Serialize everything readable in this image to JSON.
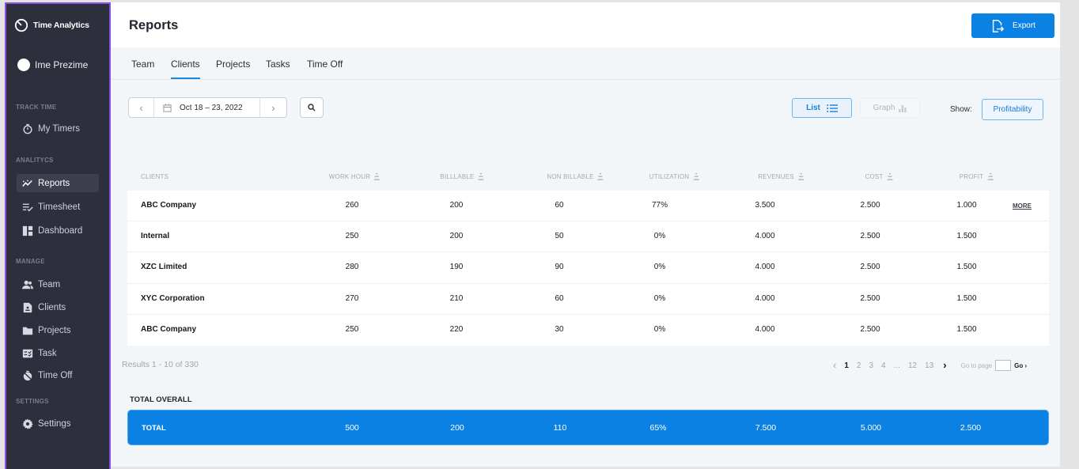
{
  "sidebar": {
    "brand": "Time Analytics",
    "user": "Ime Prezime",
    "sections": {
      "track_time": "TRACK TIME",
      "analytics": "ANALITYCS",
      "manage": "MANAGE",
      "settings": "SETTINGS"
    },
    "items": [
      {
        "label": "My Timers",
        "icon": "stopwatch-icon"
      },
      {
        "label": "Reports",
        "icon": "trend-icon",
        "active": true
      },
      {
        "label": "Timesheet",
        "icon": "checklist-icon"
      },
      {
        "label": "Dashboard",
        "icon": "dashboard-icon"
      },
      {
        "label": "Team",
        "icon": "team-icon"
      },
      {
        "label": "Clients",
        "icon": "client-icon"
      },
      {
        "label": "Projects",
        "icon": "folder-icon"
      },
      {
        "label": "Task",
        "icon": "task-icon"
      },
      {
        "label": "Time Off",
        "icon": "time-off-icon"
      },
      {
        "label": "Settings",
        "icon": "gear-icon"
      }
    ]
  },
  "header": {
    "title": "Reports",
    "export_label": "Export"
  },
  "tabs": [
    {
      "label": "Team"
    },
    {
      "label": "Clients",
      "active": true
    },
    {
      "label": "Projects"
    },
    {
      "label": "Tasks"
    },
    {
      "label": "Time Off"
    }
  ],
  "toolbar": {
    "date_range": "Oct 18 – 23, 2022",
    "list_label": "List",
    "graph_label": "Graph",
    "show_label": "Show:",
    "show_value": "Profitability"
  },
  "table": {
    "columns": [
      "CLIENTS",
      "WORK HOUR",
      "BILLLABLE",
      "NON BILLABLE",
      "UTILIZATION",
      "REVENUES",
      "COST",
      "PROFIT"
    ],
    "rows": [
      [
        "ABC Company",
        "260",
        "200",
        "60",
        "77%",
        "3.500",
        "2.500",
        "1.000"
      ],
      [
        "Internal",
        "250",
        "200",
        "50",
        "0%",
        "4.000",
        "2.500",
        "1.500"
      ],
      [
        "XZC Limited",
        "280",
        "190",
        "90",
        "0%",
        "4.000",
        "2.500",
        "1.500"
      ],
      [
        "XYC Corporation",
        "270",
        "210",
        "60",
        "0%",
        "4.000",
        "2.500",
        "1.500"
      ],
      [
        "ABC Company",
        "250",
        "220",
        "30",
        "0%",
        "4.000",
        "2.500",
        "1.500"
      ]
    ],
    "more_label": "MORE"
  },
  "pagination": {
    "results": "Results 1 - 10 of 330",
    "pages": [
      "1",
      "2",
      "3",
      "4",
      "...",
      "12",
      "13"
    ],
    "current": "1",
    "goto_label": "Go to page",
    "go_label": "Go ›"
  },
  "totals": {
    "title": "TOTAL OVERALL",
    "row": [
      "TOTAL",
      "500",
      "200",
      "110",
      "65%",
      "7.500",
      "5.000",
      "2.500"
    ]
  },
  "colors": {
    "accent": "#0a81e3",
    "sidebar_bg": "#2d2f3d",
    "sidebar_border": "#8a4fe6"
  }
}
